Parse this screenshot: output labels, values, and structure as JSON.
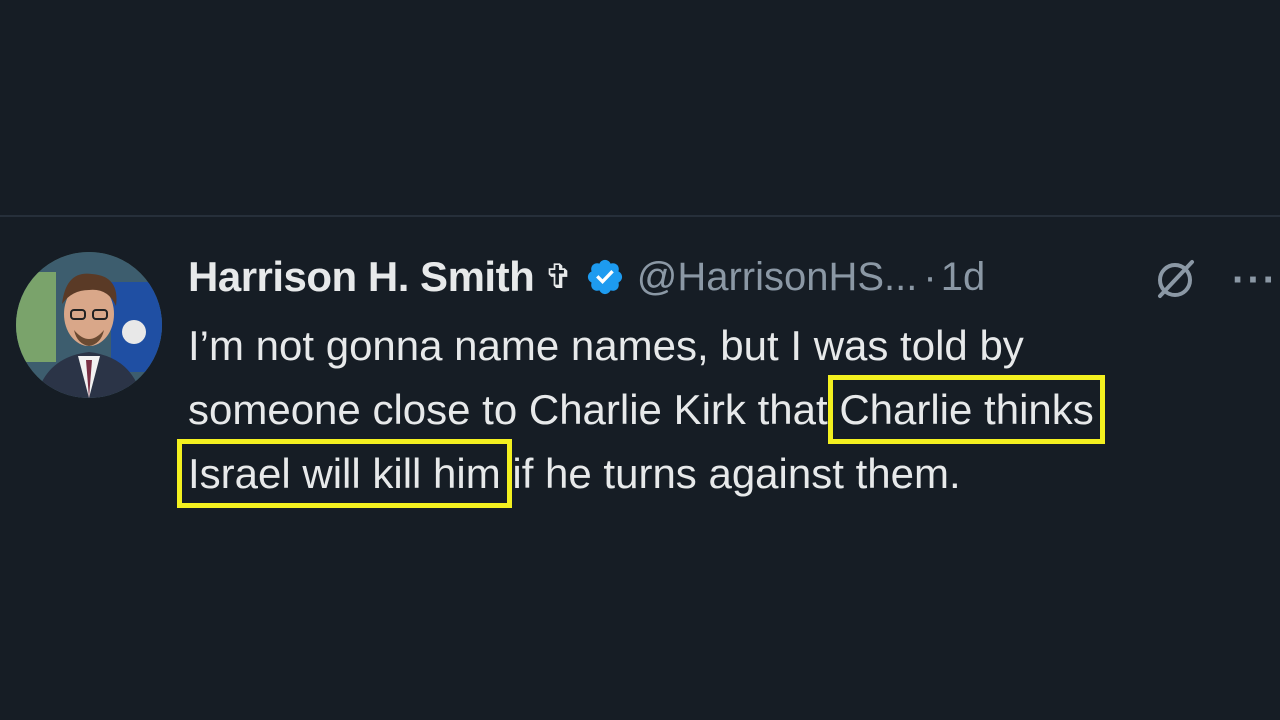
{
  "tweet": {
    "author_name": "Harrison H. Smith",
    "name_symbol": "✞",
    "verified_icon": "verified-badge-icon",
    "handle": "@HarrisonHS...",
    "separator": "·",
    "time": "1d",
    "grok_icon": "grok-icon",
    "more_icon": "more-options-icon",
    "more_glyph": "···",
    "text": {
      "line1": "I’m not gonna name names, but I was told by",
      "line2_pre": "someone close to Charlie Kirk that ",
      "line2_highlight": "Charlie thinks",
      "line3_highlight": "Israel will kill him",
      "line3_post": " if he turns against them."
    }
  },
  "colors": {
    "background": "#161d25",
    "text": "#e7e9ea",
    "muted": "#8b98a5",
    "verified": "#1d9bf0",
    "highlight_box": "#f3f01f"
  }
}
